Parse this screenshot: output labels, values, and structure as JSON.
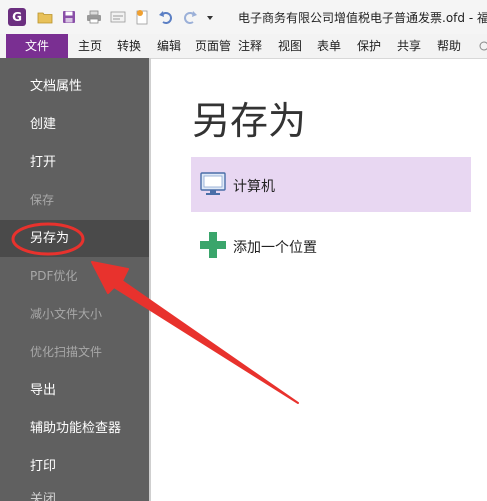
{
  "window": {
    "title": "电子商务有限公司增值税电子普通发票.ofd - 福",
    "quick_access_icons": [
      "app-logo",
      "open-folder-icon",
      "save-icon",
      "print-icon",
      "scan-icon",
      "new-icon",
      "undo-icon",
      "redo-icon",
      "dropdown-icon"
    ],
    "app_logo_text": "G"
  },
  "menu": {
    "file": "文件",
    "items": [
      "主页",
      "转换",
      "编辑",
      "页面管",
      "注释",
      "视图",
      "表单",
      "保护",
      "共享",
      "帮助"
    ]
  },
  "sidebar": {
    "items": [
      {
        "label": "文档属性",
        "state": "normal"
      },
      {
        "label": "创建",
        "state": "normal"
      },
      {
        "label": "打开",
        "state": "normal"
      },
      {
        "label": "保存",
        "state": "disabled"
      },
      {
        "label": "另存为",
        "state": "selected"
      },
      {
        "label": "PDF优化",
        "state": "disabled"
      },
      {
        "label": "减小文件大小",
        "state": "disabled"
      },
      {
        "label": "优化扫描文件",
        "state": "disabled"
      },
      {
        "label": "导出",
        "state": "normal"
      },
      {
        "label": "辅助功能检查器",
        "state": "normal"
      },
      {
        "label": "打印",
        "state": "normal"
      },
      {
        "label": "关闭",
        "state": "normal"
      }
    ]
  },
  "main": {
    "title": "另存为",
    "locations": [
      {
        "label": "计算机",
        "icon": "computer-icon"
      },
      {
        "label": "添加一个位置",
        "icon": "plus-icon"
      }
    ]
  },
  "colors": {
    "file_menu": "#7a2f92",
    "sidebar_bg": "#606060",
    "selected_item": "#4a4a4a",
    "computer_highlight": "#e8d7f2",
    "annotation_red": "#e8322d",
    "plus_green": "#3aa56b"
  }
}
